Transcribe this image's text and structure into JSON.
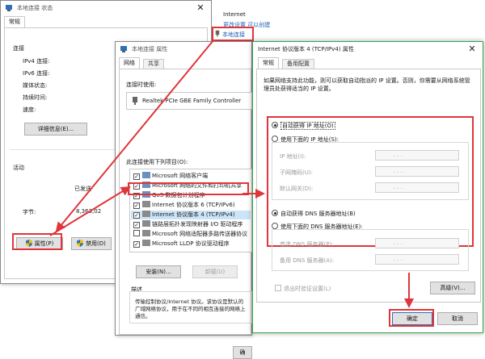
{
  "status_window": {
    "title": "本地连接 状态",
    "tab_general": "常规",
    "section_connection": "连接",
    "ipv4": "IPv4 连接:",
    "ipv6": "IPv6 连接:",
    "media_state": "媒体状态:",
    "duration": "持续时间:",
    "speed": "速度:",
    "details_btn": "详细信息(E)...",
    "section_activity": "活动",
    "sent": "已发送",
    "bytes_label": "字节:",
    "bytes_value": "8,363,02",
    "properties_btn": "属性(P)",
    "disable_btn": "禁用(D)"
  },
  "network_connections": {
    "title": "Internet",
    "links": "更改设置   可以创建",
    "local_connection": "本地连接"
  },
  "properties_window": {
    "title": "本地连接 属性",
    "tab_network": "网络",
    "tab_sharing": "共享",
    "connect_using": "连接时使用:",
    "adapter": "Realtek PCIe GBE Family Controller",
    "items_label": "此连接使用下列项目(O):",
    "items": [
      {
        "label": "Microsoft 网络客户端",
        "checked": true
      },
      {
        "label": "Microsoft 网络的文件和打印机共享",
        "checked": true
      },
      {
        "label": "QoS 数据包计划程序",
        "checked": true
      },
      {
        "label": "Internet 协议版本 6 (TCP/IPv6)",
        "checked": true
      },
      {
        "label": "Internet 协议版本 4 (TCP/IPv4)",
        "checked": true
      },
      {
        "label": "链路层拓扑发现映射器 I/O 驱动程序",
        "checked": true
      },
      {
        "label": "Microsoft 网络适配器多路传送器协议",
        "checked": false
      },
      {
        "label": "Microsoft LLDP 协议驱动程序",
        "checked": true
      }
    ],
    "install_btn": "安装(N)...",
    "uninstall_btn": "卸载(U)",
    "description_label": "描述",
    "description": "传输控制协议/Internet 协议。该协议是默认的广域网络协议，用于在不同的相互连接的网络上通信。",
    "ok_btn": "确"
  },
  "ipv4_window": {
    "title": "Internet 协议版本 4 (TCP/IPv4) 属性",
    "tab_general": "常规",
    "tab_alternate": "备用配置",
    "intro": "如果网络支持此功能，则可以获取自动指派的 IP 设置。否则，你需要从网络系统管理员处获得适当的 IP 设置。",
    "auto_ip": "自动获得 IP 地址(O)",
    "manual_ip": "使用下面的 IP 地址(S):",
    "ip_address": "IP 地址(I):",
    "subnet_mask": "子网掩码(U):",
    "gateway": "默认网关(D):",
    "auto_dns": "自动获得 DNS 服务器地址(B)",
    "manual_dns": "使用下面的 DNS 服务器地址(E):",
    "preferred_dns": "首选 DNS 服务器(P):",
    "alternate_dns": "备用 DNS 服务器(A):",
    "validate_on_exit": "退出时验证设置(L)",
    "advanced_btn": "高级(V)...",
    "ok_btn": "确定",
    "cancel_btn": "取消",
    "ip_dots": ".       .       ."
  },
  "colors": {
    "highlight": "#e0353a",
    "arrow": "#e0353a",
    "link": "#1a5fb4",
    "selection": "#cce4f7"
  },
  "icons": [
    "network-icon",
    "close-icon",
    "shield-icon",
    "network-adapter-icon"
  ]
}
